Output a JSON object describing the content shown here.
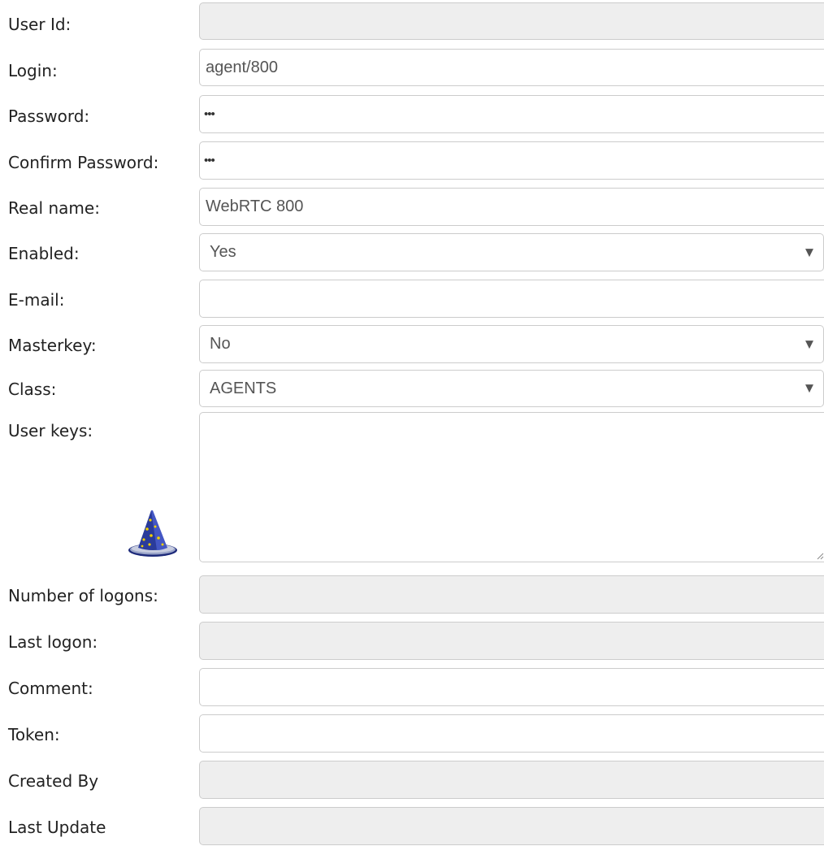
{
  "form": {
    "user_id": {
      "label": "User Id:",
      "value": ""
    },
    "login": {
      "label": "Login:",
      "value": "agent/800"
    },
    "password": {
      "label": "Password:",
      "value": "•••"
    },
    "confirm_password": {
      "label": "Confirm Password:",
      "value": "•••"
    },
    "real_name": {
      "label": "Real name:",
      "value": "WebRTC 800"
    },
    "enabled": {
      "label": "Enabled:",
      "value": "Yes"
    },
    "email": {
      "label": "E-mail:",
      "value": ""
    },
    "masterkey": {
      "label": "Masterkey:",
      "value": "No"
    },
    "class": {
      "label": "Class:",
      "value": "AGENTS"
    },
    "user_keys": {
      "label": "User keys:",
      "value": ""
    },
    "number_of_logons": {
      "label": "Number of logons:",
      "value": ""
    },
    "last_logon": {
      "label": "Last logon:",
      "value": ""
    },
    "comment": {
      "label": "Comment:",
      "value": ""
    },
    "token": {
      "label": "Token:",
      "value": ""
    },
    "created_by": {
      "label": "Created By",
      "value": ""
    },
    "last_update": {
      "label": "Last Update",
      "value": ""
    }
  },
  "icons": {
    "select_caret": "chevron-down-icon",
    "wizard": "wizard-hat-icon"
  },
  "colors": {
    "border": "#cccccc",
    "readonly_bg": "#eeeeee",
    "input_text": "#555555",
    "label_text": "#222222",
    "wizard_hat": "#2a3b9b",
    "wizard_stars": "#f0d000"
  }
}
